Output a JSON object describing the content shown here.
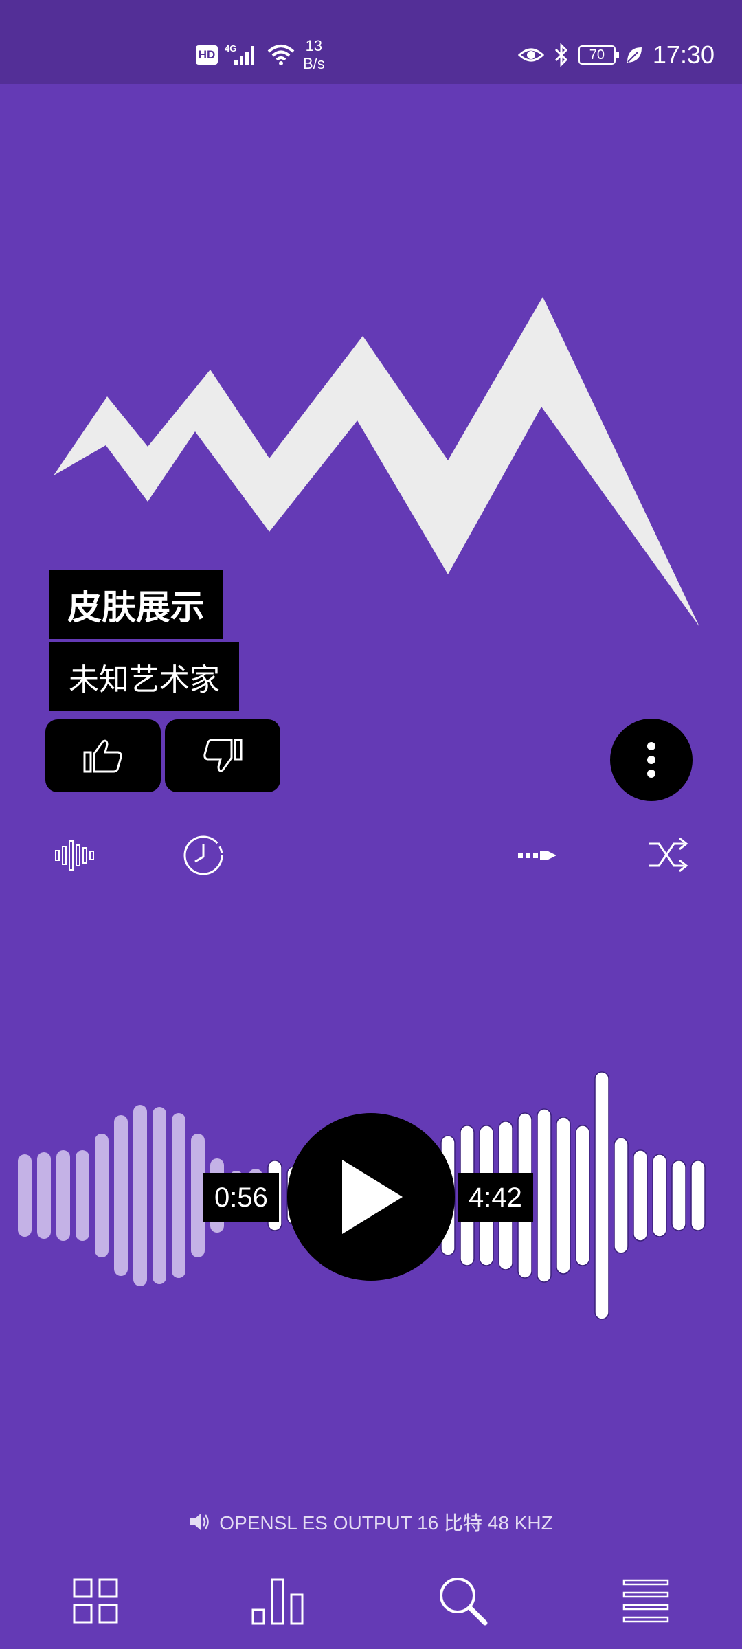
{
  "status_bar": {
    "hd_label": "HD",
    "network_label": "4G",
    "speed_value": "13",
    "speed_unit": "B/s",
    "battery_level": "70",
    "time": "17:30",
    "icons": [
      "hd-icon",
      "signal-icon",
      "wifi-icon",
      "eye-icon",
      "bluetooth-icon",
      "battery-icon",
      "leaf-icon"
    ]
  },
  "track": {
    "title": "皮肤展示",
    "artist": "未知艺术家"
  },
  "rating": {
    "like_icon": "thumbs-up-icon",
    "dislike_icon": "thumbs-down-icon"
  },
  "controls": {
    "icons": [
      "waveform-icon",
      "timer-icon",
      "repeat-next-icon",
      "shuffle-icon"
    ]
  },
  "player": {
    "elapsed": "0:56",
    "total": "4:42",
    "play_icon": "play-icon",
    "progress": 0.2
  },
  "output": {
    "label": "OPENSL ES OUTPUT  16 比特  48 KHZ",
    "icon": "speaker-icon"
  },
  "bottom_nav": {
    "icons": [
      "grid-icon",
      "bar-chart-icon",
      "search-icon",
      "menu-icon"
    ]
  },
  "colors": {
    "background": "#643ab5",
    "status_bar": "#532f97",
    "wave_played": "#c4b2e6",
    "wave_unplayed": "#ffffff",
    "accent_black": "#000000"
  }
}
